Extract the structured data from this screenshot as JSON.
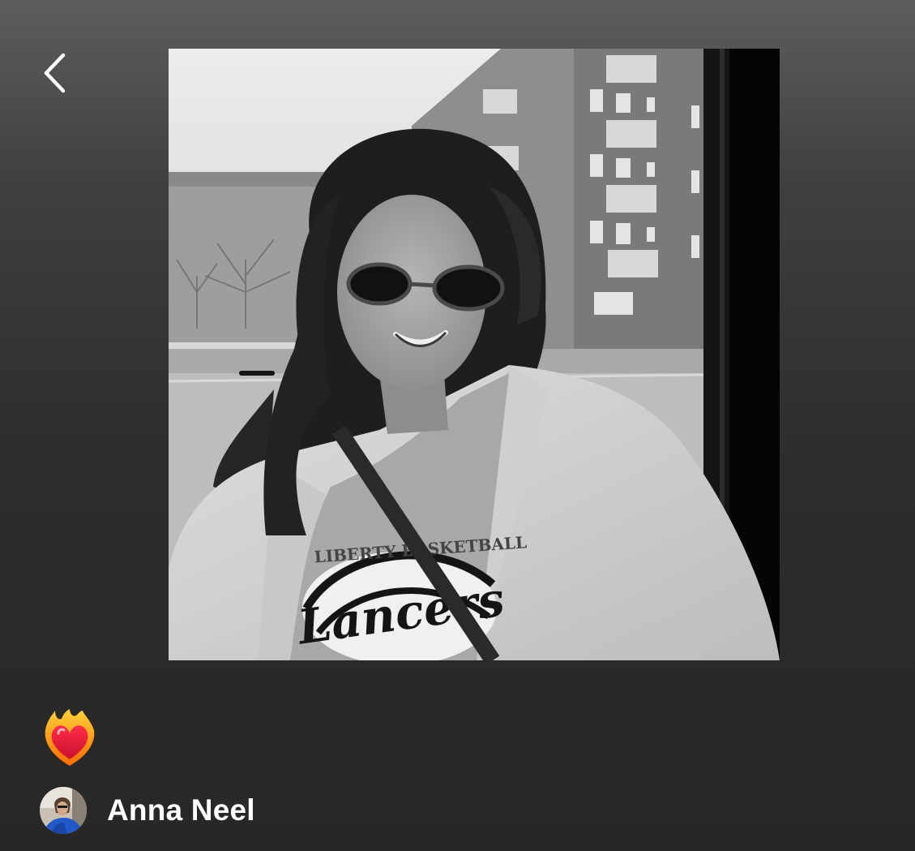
{
  "header": {
    "back_icon": "chevron-left-icon"
  },
  "cover": {
    "description_icon": "playlist-cover-photo",
    "sweatshirt_text_top": "LIBERTY BASKETBALL",
    "sweatshirt_text_main": "Lancers"
  },
  "playlist": {
    "emoji_icon": "heart-on-fire-emoji",
    "owner_name": "Anna Neel"
  },
  "colors": {
    "background_top": "#5d5d5d",
    "background_bottom": "#272727",
    "text": "#ffffff"
  }
}
